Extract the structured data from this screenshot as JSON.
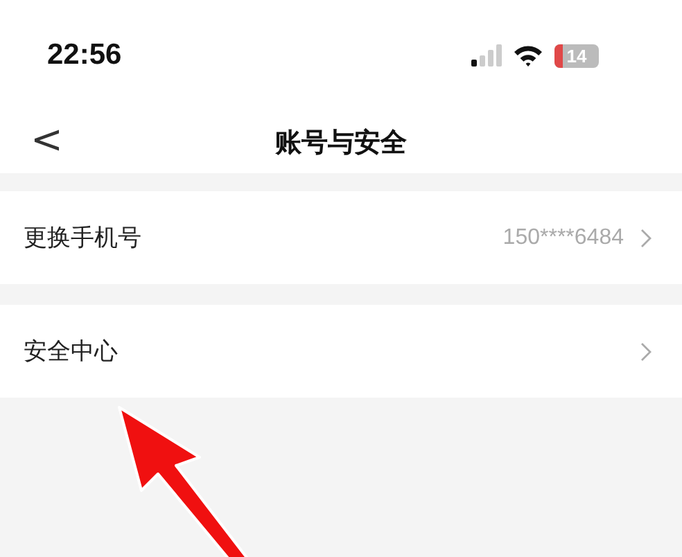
{
  "status_bar": {
    "time": "22:56",
    "battery": "14"
  },
  "nav": {
    "back": "<",
    "title": "账号与安全"
  },
  "rows": [
    {
      "label": "更换手机号",
      "value": "150****6484"
    },
    {
      "label": "安全中心"
    }
  ]
}
